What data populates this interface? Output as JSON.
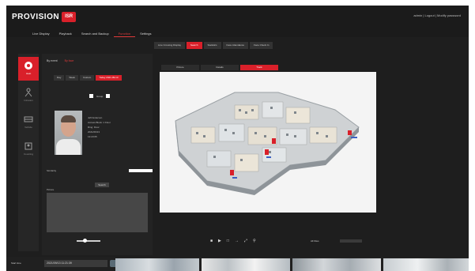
{
  "app": {
    "brand": "PROVISION",
    "brand_badge": "ISR",
    "user_links": "admin | Logout | Modify password",
    "nav": [
      "Live Display",
      "Playback",
      "Search and Backup",
      "Function",
      "Settings"
    ],
    "active_nav": "Function"
  },
  "sidebar": {
    "items": [
      {
        "label": "Heat",
        "icon": "heat-map-icon"
      },
      {
        "label": "Intrusion",
        "icon": "person-icon"
      },
      {
        "label": "Vehicle",
        "icon": "vehicle-icon"
      },
      {
        "label": "Counting",
        "icon": "people-count-icon"
      }
    ]
  },
  "subtabs": [
    "Line Crossing Display",
    "Search",
    "Statistics",
    "Face Attendance",
    "Face Check In"
  ],
  "active_subtab": "Search",
  "panel": {
    "header_left": "By event",
    "header_right": "By face",
    "buttons": [
      "Day",
      "Week",
      "Custom",
      "Today 2021-09-13"
    ],
    "checkbox_label": "Group",
    "info": [
      "Jeff Anderson",
      "Access Block: 1 Floor",
      "Ring: Floor",
      "2021/09/13",
      "13:23:05"
    ],
    "threshold_label": "Similarity",
    "search_button": "Search",
    "picture_label": "Picture"
  },
  "view_tabs": [
    "Picture",
    "Details",
    "Track"
  ],
  "active_view": "Track",
  "controls": {
    "buttons": [
      "prev-icon",
      "play-icon",
      "stop-icon",
      "next-icon",
      "fullscreen-icon",
      "search-icon"
    ],
    "rate_label": "All Files"
  },
  "bottom": {
    "label": "Start time",
    "time": "2021/09/13 11:21:39"
  },
  "colors": {
    "accent": "#d9202a",
    "background": "#1e1e1e",
    "panel": "#232323"
  }
}
